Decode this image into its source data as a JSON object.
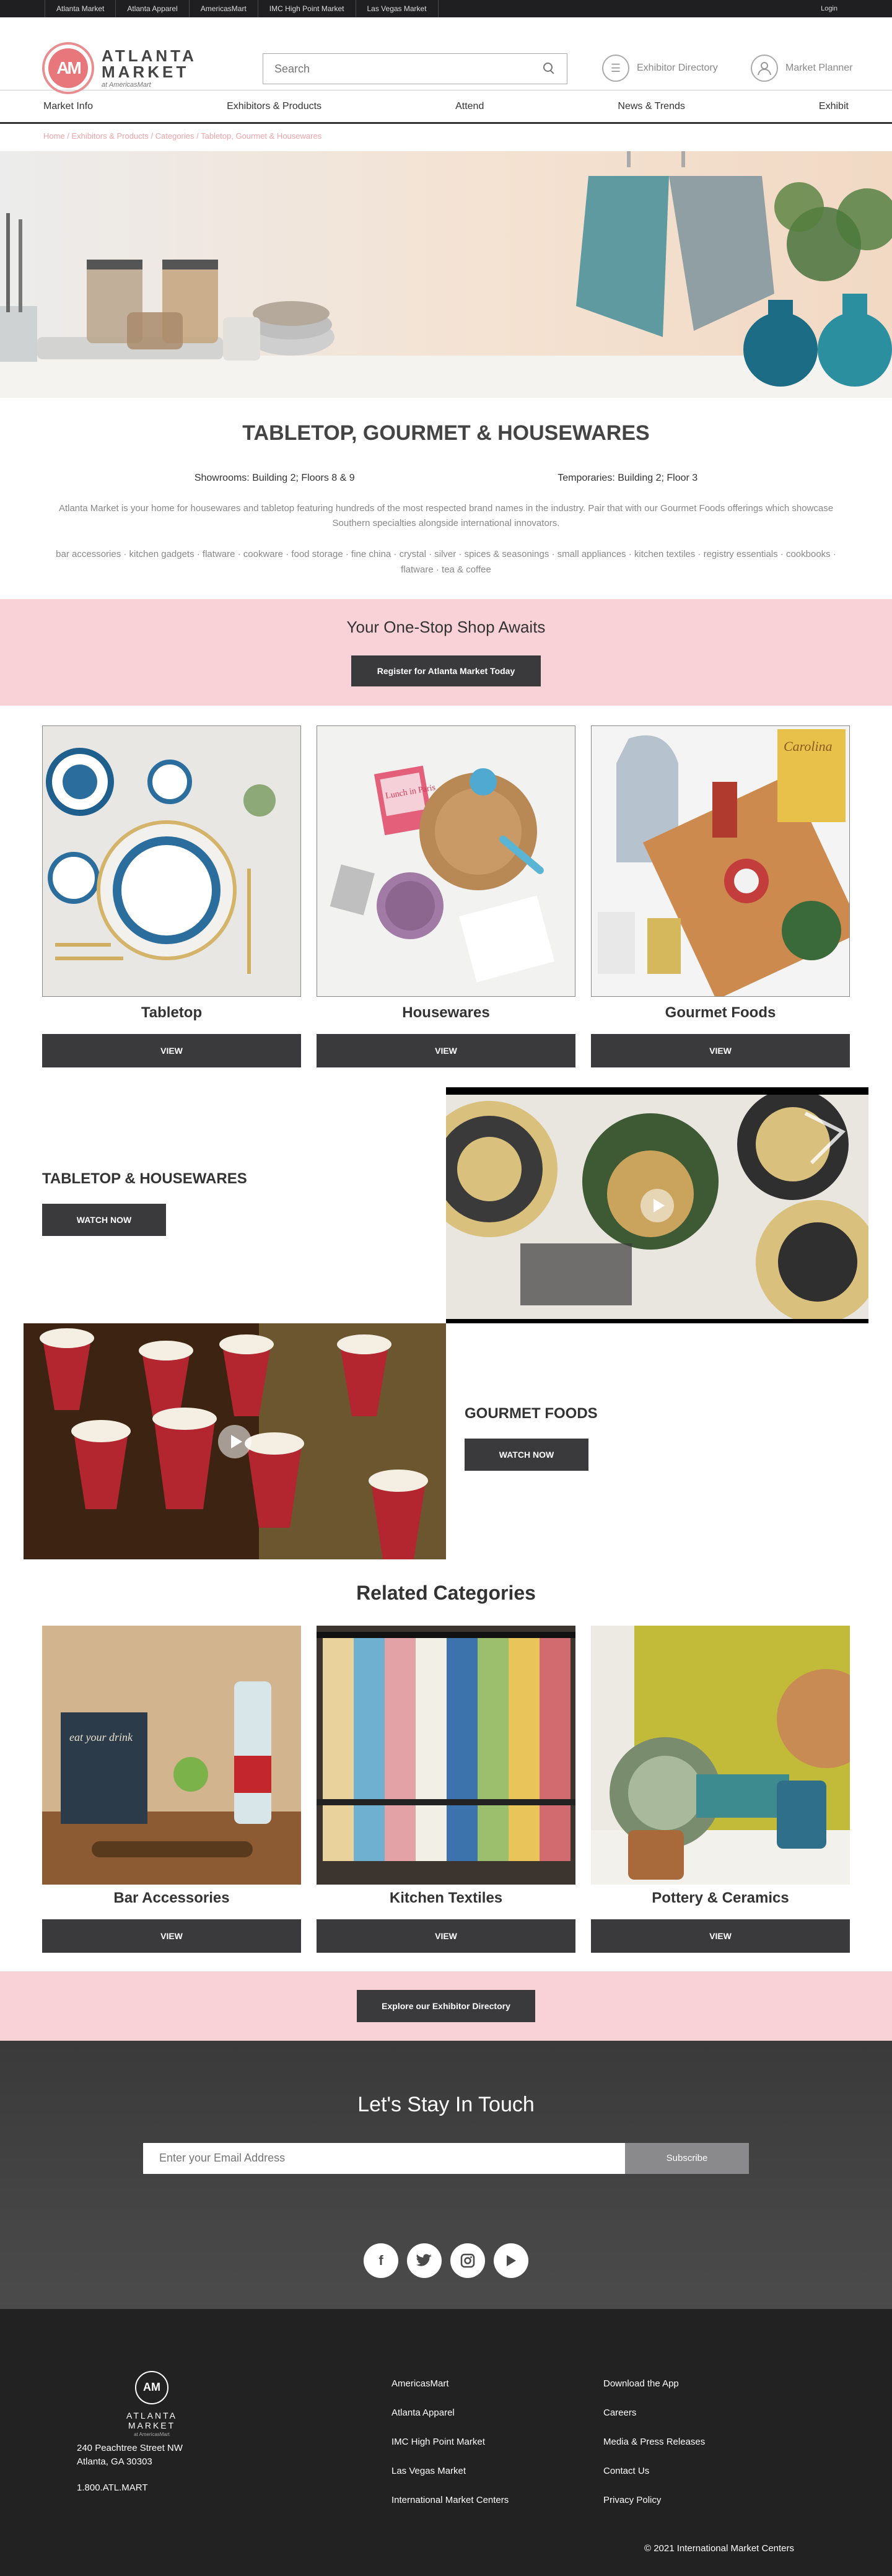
{
  "topbar": {
    "links": [
      "Atlanta Market",
      "Atlanta Apparel",
      "AmericasMart",
      "IMC High Point Market",
      "Las Vegas Market"
    ],
    "login": "Login"
  },
  "header": {
    "logo_initials": "AM",
    "logo_line1": "ATLANTA",
    "logo_line2": "MARKET",
    "logo_line3": "at AmericasMart",
    "search_placeholder": "Search",
    "exhibitor_directory": "Exhibitor Directory",
    "market_planner": "Market Planner"
  },
  "nav": [
    "Market Info",
    "Exhibitors & Products",
    "Attend",
    "News & Trends",
    "Exhibit"
  ],
  "breadcrumb": "Home / Exhibitors & Products / Categories / Tabletop, Gourmet & Housewares",
  "page": {
    "title": "TABLETOP, GOURMET & HOUSEWARES",
    "showrooms": "Showrooms: Building 2; Floors 8 & 9",
    "temporaries": "Temporaries: Building 2; Floor 3",
    "intro": "Atlanta Market is your home for housewares and tabletop featuring hundreds of the most respected brand names in the industry. Pair that with our Gourmet Foods offerings which showcase Southern specialties alongside international innovators.",
    "keywords": "bar accessories · kitchen gadgets · flatware · cookware · food storage · fine china · crystal · silver · spices & seasonings · small appliances · kitchen textiles · registry essentials · cookbooks · flatware · tea & coffee"
  },
  "promo": {
    "heading": "Your One-Stop Shop Awaits",
    "button": "Register for Atlanta Market Today"
  },
  "categories": [
    {
      "title": "Tabletop",
      "button": "VIEW"
    },
    {
      "title": "Housewares",
      "button": "VIEW"
    },
    {
      "title": "Gourmet Foods",
      "button": "VIEW"
    }
  ],
  "videos": [
    {
      "title": "TABLETOP & HOUSEWARES",
      "button": "WATCH NOW"
    },
    {
      "title": "GOURMET FOODS",
      "button": "WATCH NOW"
    }
  ],
  "hero_books": {
    "lunch_book": "Lunch in Paris",
    "chips_bag": "Carolina",
    "drink_book": "eat your drink"
  },
  "related": {
    "heading": "Related Categories",
    "items": [
      {
        "title": "Bar Accessories",
        "button": "VIEW"
      },
      {
        "title": "Kitchen Textiles",
        "button": "VIEW"
      },
      {
        "title": "Pottery & Ceramics",
        "button": "VIEW"
      }
    ]
  },
  "directory_cta": "Explore our Exhibitor Directory",
  "newsletter": {
    "heading": "Let's Stay In Touch",
    "placeholder": "Enter your Email Address",
    "button": "Subscribe"
  },
  "social_icons": [
    "facebook-icon",
    "twitter-icon",
    "instagram-icon",
    "youtube-icon"
  ],
  "footer": {
    "logo_initials": "AM",
    "logo_text": "ATLANTA MARKET",
    "logo_sub": "at AmericasMart",
    "address_line1": "240 Peachtree Street NW",
    "address_line2": "Atlanta, GA 30303",
    "phone": "1.800.ATL.MART",
    "col1": [
      "AmericasMart",
      "Atlanta Apparel",
      "IMC High Point Market",
      "Las Vegas Market",
      "International Market Centers"
    ],
    "col2": [
      "Download the App",
      "Careers",
      "Media & Press Releases",
      "Contact Us",
      "Privacy Policy"
    ],
    "copyright": "© 2021 International Market Centers"
  },
  "colors": {
    "accent_pink": "#f8d2d6",
    "logo_red": "#e8777b",
    "button_dark": "#3a3a3c",
    "footer_bg": "#222222"
  }
}
